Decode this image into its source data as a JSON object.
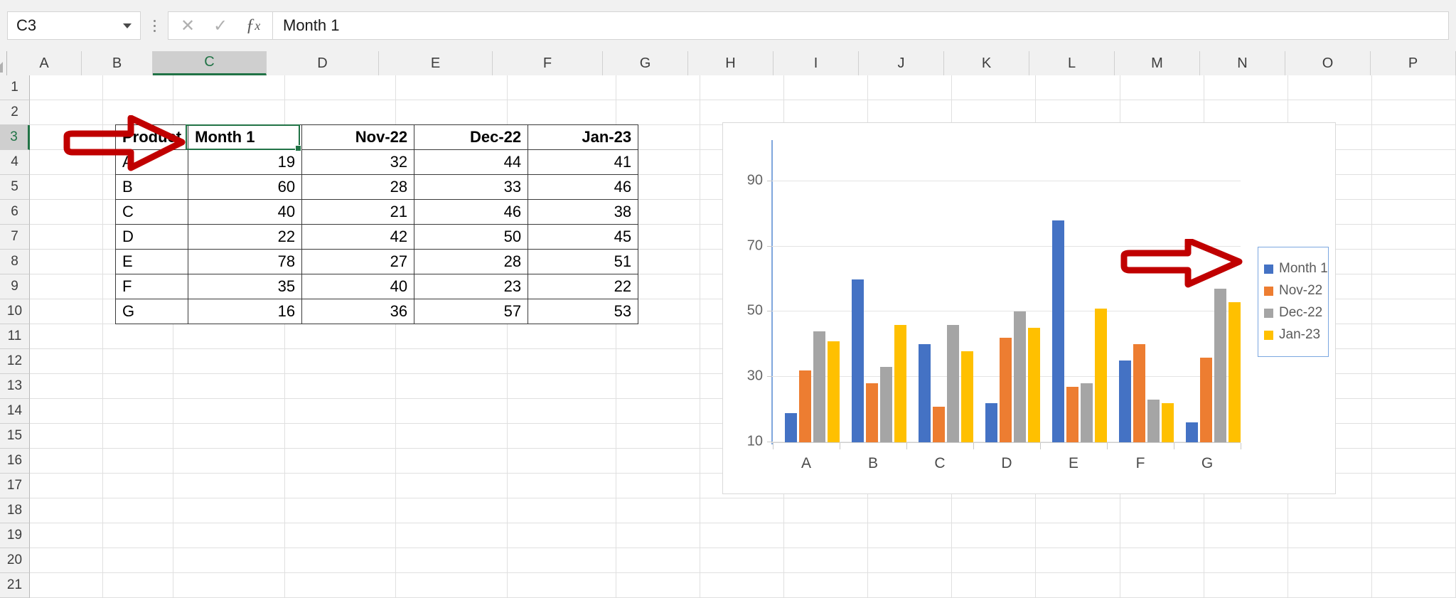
{
  "formula_bar": {
    "name_box_value": "C3",
    "cancel_icon": "close-icon",
    "confirm_icon": "check-icon",
    "function_icon": "fx",
    "formula_value": "Month 1"
  },
  "sheet": {
    "column_headers": [
      "A",
      "B",
      "C",
      "D",
      "E",
      "F",
      "G",
      "H",
      "I",
      "J",
      "K",
      "L",
      "M",
      "N",
      "O",
      "P"
    ],
    "active_column": "C",
    "row_headers": [
      "1",
      "2",
      "3",
      "4",
      "5",
      "6",
      "7",
      "8",
      "9",
      "10",
      "11",
      "12",
      "13",
      "14",
      "15",
      "16",
      "17",
      "18",
      "19",
      "20",
      "21"
    ],
    "active_row": "3"
  },
  "table": {
    "headers": [
      "Product",
      "Month 1",
      "Nov-22",
      "Dec-22",
      "Jan-23"
    ],
    "rows": [
      {
        "product": "A",
        "month1": "19",
        "nov22": "32",
        "dec22": "44",
        "jan23": "41"
      },
      {
        "product": "B",
        "month1": "60",
        "nov22": "28",
        "dec22": "33",
        "jan23": "46"
      },
      {
        "product": "C",
        "month1": "40",
        "nov22": "21",
        "dec22": "46",
        "jan23": "38"
      },
      {
        "product": "D",
        "month1": "22",
        "nov22": "42",
        "dec22": "50",
        "jan23": "45"
      },
      {
        "product": "E",
        "month1": "78",
        "nov22": "27",
        "dec22": "28",
        "jan23": "51"
      },
      {
        "product": "F",
        "month1": "35",
        "nov22": "40",
        "dec22": "23",
        "jan23": "22"
      },
      {
        "product": "G",
        "month1": "16",
        "nov22": "36",
        "dec22": "57",
        "jan23": "53"
      }
    ]
  },
  "chart_data": {
    "type": "bar",
    "title": "",
    "xlabel": "",
    "ylabel": "",
    "categories": [
      "A",
      "B",
      "C",
      "D",
      "E",
      "F",
      "G"
    ],
    "series": [
      {
        "name": "Month 1",
        "color": "#4472c4",
        "values": [
          19,
          60,
          40,
          22,
          78,
          35,
          16
        ]
      },
      {
        "name": "Nov-22",
        "color": "#ed7d31",
        "values": [
          32,
          28,
          21,
          42,
          27,
          40,
          36
        ]
      },
      {
        "name": "Dec-22",
        "color": "#a5a5a5",
        "values": [
          44,
          33,
          46,
          50,
          28,
          23,
          57
        ]
      },
      {
        "name": "Jan-23",
        "color": "#ffc000",
        "values": [
          41,
          46,
          38,
          45,
          51,
          22,
          53
        ]
      }
    ],
    "ylim": [
      10,
      95
    ],
    "y_ticks": [
      10,
      30,
      50,
      70,
      90
    ],
    "grid": true,
    "legend_position": "right"
  },
  "annotations": {
    "arrow_table_label": "red-arrow-pointing-to-header-cell",
    "arrow_legend_label": "red-arrow-pointing-to-legend"
  },
  "colors": {
    "series_blue": "#4472c4",
    "series_orange": "#ed7d31",
    "series_gray": "#a5a5a5",
    "series_yellow": "#ffc000",
    "excel_green": "#217346",
    "annotation_red": "#c00000"
  }
}
